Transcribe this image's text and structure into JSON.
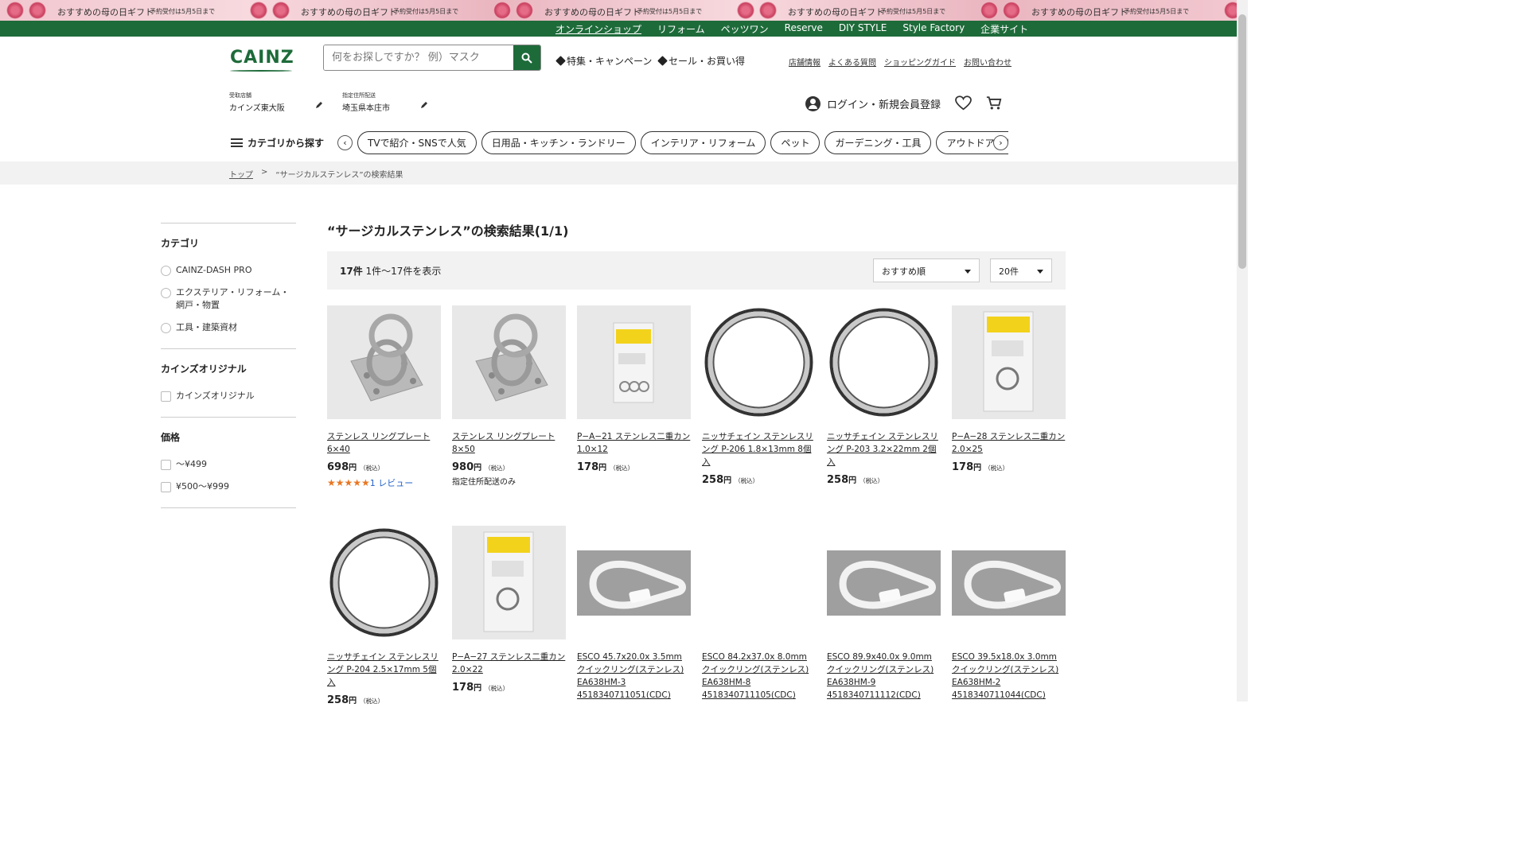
{
  "banner": {
    "text": "おすすめの母の日ギフト",
    "sub": "予約受付は5月5日まで"
  },
  "topnav": [
    "オンラインショップ",
    "リフォーム",
    "ペッツワン",
    "Reserve",
    "DIY STYLE",
    "Style Factory",
    "企業サイト"
  ],
  "header": {
    "logo": "CAINZ",
    "search_placeholder": "何をお探しですか？ 例）マスク",
    "promo1": "特集・キャンペーン",
    "promo2": "セール・お買い得",
    "links": [
      "店舗情報",
      "よくある質問",
      "ショッピングガイド",
      "お問い合わせ"
    ],
    "store_label": "受取店舗",
    "store_value": "カインズ東大阪",
    "address_label": "指定住所配送",
    "address_value": "埼玉県本庄市",
    "login": "ログイン・新規会員登録"
  },
  "category": {
    "button": "カテゴリから探す",
    "pills": [
      "TVで紹介・SNSで人気",
      "日用品・キッチン・ランドリー",
      "インテリア・リフォーム",
      "ペット",
      "ガーデニング・工具",
      "アウトドア・カー用品"
    ]
  },
  "breadcrumb": {
    "home": "トップ",
    "sep": ">",
    "current": "“サージカルステンレス”の検索結果"
  },
  "sidebar": {
    "cat_title": "カテゴリ",
    "cats": [
      "CAINZ-DASH PRO",
      "エクステリア・リフォーム・網戸・物置",
      "工具・建築資材"
    ],
    "orig_title": "カインズオリジナル",
    "orig": [
      "カインズオリジナル"
    ],
    "price_title": "価格",
    "prices": [
      "～¥499",
      "¥500～¥999"
    ]
  },
  "results": {
    "title": "“サージカルステンレス”の検索結果(1/1)",
    "count": "17件",
    "range": "1件～17件を表示",
    "sort": "おすすめ順",
    "per_page": "20件"
  },
  "products": [
    {
      "name": "ステンレス リングプレート 6×40",
      "price": "698",
      "yen": "円",
      "tax": "（税込）",
      "stars": "★★★★★",
      "reviews": "1 レビュー",
      "img": "ring-plate"
    },
    {
      "name": "ステンレス リングプレート 8×50",
      "price": "980",
      "yen": "円",
      "tax": "（税込）",
      "note": "指定住所配送のみ",
      "img": "ring-plate"
    },
    {
      "name": "P−A−21 ステンレス二重カン 1.0×12",
      "price": "178",
      "yen": "円",
      "tax": "（税込）",
      "img": "package"
    },
    {
      "name": "ニッサチェイン ステンレスリング P-206 1.8×13mm 8個入",
      "price": "258",
      "yen": "円",
      "tax": "（税込）",
      "img": "ring"
    },
    {
      "name": "ニッサチェイン ステンレスリング P-203 3.2×22mm 2個入",
      "price": "258",
      "yen": "円",
      "tax": "（税込）",
      "img": "ring"
    },
    {
      "name": "P−A−28 ステンレス二重カン 2.0×25",
      "price": "178",
      "yen": "円",
      "tax": "（税込）",
      "img": "package-single"
    },
    {
      "name": "ニッサチェイン ステンレスリング P-204 2.5×17mm 5個入",
      "price": "258",
      "yen": "円",
      "tax": "（税込）",
      "img": "ring"
    },
    {
      "name": "P−A−27 ステンレス二重カン 2.0×22",
      "price": "178",
      "yen": "円",
      "tax": "（税込）",
      "img": "package-single"
    },
    {
      "name": "ESCO 45.7x20.0x 3.5mm クイックリング(ステンレス) EA638HM-3 4518340711051(CDC)",
      "img": "quicklink"
    },
    {
      "name": "ESCO 84.2x37.0x 8.0mm クイックリング(ステンレス) EA638HM-8 4518340711105(CDC)",
      "img": "none"
    },
    {
      "name": "ESCO 89.9x40.0x 9.0mm クイックリング(ステンレス) EA638HM-9 4518340711112(CDC)",
      "img": "quicklink"
    },
    {
      "name": "ESCO 39.5x18.0x 3.0mm クイックリング(ステンレス) EA638HM-2 4518340711044(CDC)",
      "img": "quicklink"
    }
  ]
}
